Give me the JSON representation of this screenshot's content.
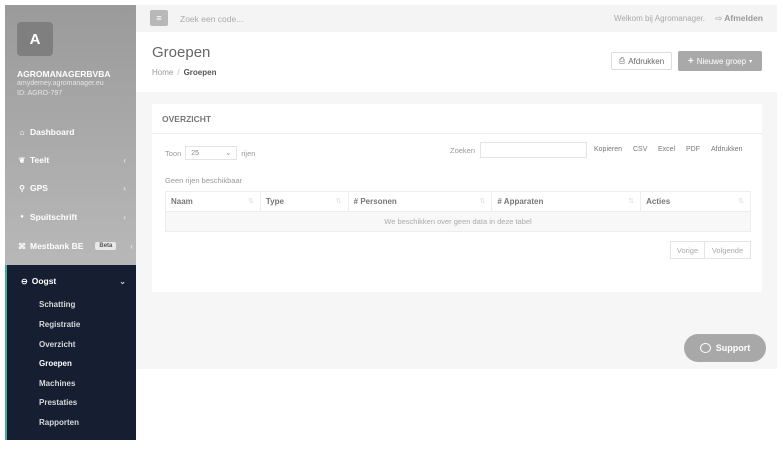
{
  "topbar": {
    "menu_icon": "hamburger-icon",
    "search_placeholder": "Zoek een code...",
    "welcome": "Welkom bij Agromanager.",
    "logout_label": "Afmelden",
    "logout_icon": "logout-icon"
  },
  "sidebar": {
    "avatar_letter": "A",
    "company": "AGROMANAGERBVBA",
    "email": "amydemey.agromanager.eu",
    "customer_id": "ID: AGRO-797",
    "items": [
      {
        "label": "Dashboard",
        "icon": "home-icon",
        "glyph": "⌂"
      },
      {
        "label": "Teelt",
        "icon": "leaf-icon",
        "glyph": "❦"
      },
      {
        "label": "GPS",
        "icon": "map-marker-icon",
        "glyph": "⚲"
      },
      {
        "label": "Spuitschrift",
        "icon": "drop-icon",
        "glyph": "●"
      },
      {
        "label": "Mestbank BE",
        "icon": "bank-icon",
        "glyph": "⌘",
        "badge": "Beta"
      }
    ],
    "chevron": "‹",
    "oogst": {
      "label": "Oogst",
      "icon": "basket-icon",
      "glyph": "⊖",
      "chevron": "⌄",
      "subitems": [
        "Schatting",
        "Registratie",
        "Overzicht",
        "Groepen",
        "Machines",
        "Prestaties",
        "Rapporten"
      ],
      "active": "Groepen"
    }
  },
  "page": {
    "title": "Groepen",
    "breadcrumb": {
      "home": "Home",
      "separator": "/",
      "current": "Groepen"
    },
    "print_label": "Afdrukken",
    "print_icon": "printer-icon",
    "new_label": "Nieuwe groep",
    "new_icon": "plus-icon"
  },
  "panel": {
    "title": "OVERZICHT",
    "show_label": "Toon",
    "rows_value": "25",
    "rows_label": "rijen",
    "search_label": "Zoeken",
    "export": [
      "Kopieren",
      "CSV",
      "Excel",
      "PDF",
      "Afdrukken"
    ],
    "no_rows": "Geen rijen beschikbaar",
    "columns": [
      "Naam",
      "Type",
      "# Personen",
      "# Apparaten",
      "Acties"
    ],
    "empty_table": "We beschikken over geen data in deze tabel",
    "prev": "Vorige",
    "next": "Volgende"
  },
  "support": {
    "label": "Support",
    "icon": "chat-bubble-icon"
  },
  "colors": {
    "sidebar_dark": "#161e32",
    "accent_green": "#3fb08f"
  }
}
